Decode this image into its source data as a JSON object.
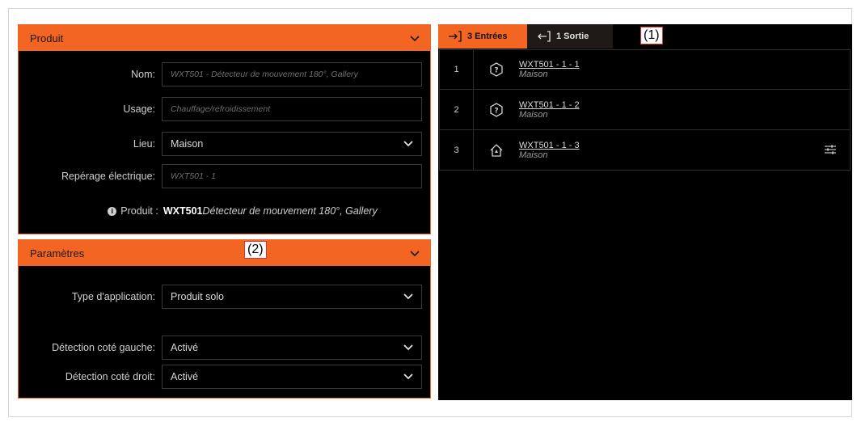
{
  "produit_panel": {
    "title": "Produit",
    "fields": {
      "nom": {
        "label": "Nom:",
        "placeholder": "WXT501 - Détecteur de mouvement 180°, Gallery"
      },
      "usage": {
        "label": "Usage:",
        "placeholder": "Chauffage/refroidissement"
      },
      "lieu": {
        "label": "Lieu:",
        "value": "Maison"
      },
      "reperage": {
        "label": "Repérage électrique:",
        "placeholder": "WXT501 - 1"
      }
    },
    "info": {
      "label": "Produit :",
      "ref": "WXT501",
      "description": "Détecteur de mouvement 180°, Gallery"
    }
  },
  "parametres_panel": {
    "title": "Paramètres",
    "fields": {
      "type_application": {
        "label": "Type d'application:",
        "value": "Produit solo"
      },
      "detection_gauche": {
        "label": "Détection coté gauche:",
        "value": "Activé"
      },
      "detection_droit": {
        "label": "Détection coté droit:",
        "value": "Activé"
      }
    }
  },
  "tabs": {
    "entrees": "3 Entrées",
    "sortie": "1 Sortie"
  },
  "annotations": {
    "one": "(1)",
    "two": "(2)"
  },
  "entries": [
    {
      "num": "1",
      "name": "WXT501 - 1 - 1",
      "location": "Maison",
      "icon": "unknown-icon"
    },
    {
      "num": "2",
      "name": "WXT501 - 1 - 2",
      "location": "Maison",
      "icon": "unknown-icon"
    },
    {
      "num": "3",
      "name": "WXT501 - 1 - 3",
      "location": "Maison",
      "icon": "home-icon"
    }
  ],
  "colors": {
    "accent": "#f26522",
    "background": "#000000"
  }
}
